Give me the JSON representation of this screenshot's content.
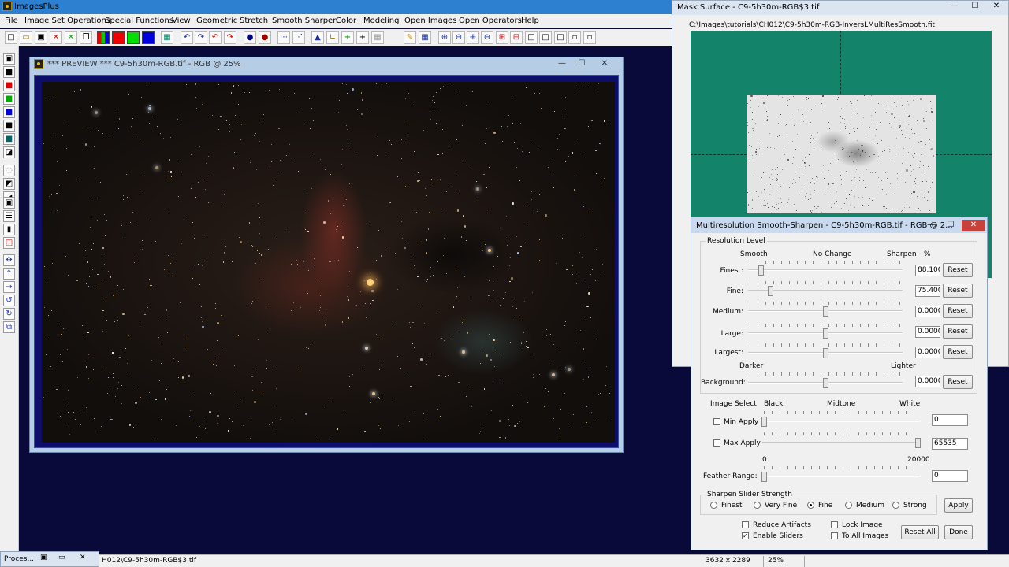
{
  "app": {
    "title": "ImagesPlus"
  },
  "menu": [
    "File",
    "Image Set Operations",
    "Special Functions",
    "View",
    "Geometric",
    "Stretch",
    "Smooth Sharpen",
    "Color",
    "Modeling",
    "Open Images",
    "Open Operators",
    "Help"
  ],
  "window_controls": {
    "minimize": "—",
    "maximize": "☐",
    "close": "✕"
  },
  "preview": {
    "title": "*** PREVIEW *** C9-5h30m-RGB.tif - RGB @ 25%"
  },
  "mask": {
    "title": "Mask Surface - C9-5h30m-RGB$3.tif",
    "path": "C:\\Images\\tutorials\\CH012\\C9-5h30m-RGB-InversLMultiResSmooth.fit",
    "accent": "#13836a"
  },
  "dialog": {
    "title": "Multiresolution Smooth-Sharpen - C9-5h30m-RGB.tif - RGB @ 2...",
    "resolution_level": {
      "group_label": "Resolution Level",
      "col_smooth": "Smooth",
      "col_nochange": "No Change",
      "col_sharpen": "Sharpen",
      "col_percent": "%",
      "rows": [
        {
          "label": "Finest:",
          "value": "88.1006",
          "reset": "Reset"
        },
        {
          "label": "Fine:",
          "value": "75.4000",
          "reset": "Reset"
        },
        {
          "label": "Medium:",
          "value": "0.0000",
          "reset": "Reset"
        },
        {
          "label": "Large:",
          "value": "0.0000",
          "reset": "Reset"
        },
        {
          "label": "Largest:",
          "value": "0.0000",
          "reset": "Reset"
        }
      ],
      "darker": "Darker",
      "lighter": "Lighter",
      "background": {
        "label": "Background:",
        "value": "0.0000",
        "reset": "Reset"
      }
    },
    "image_select": {
      "label": "Image Select",
      "black": "Black",
      "midtone": "Midtone",
      "white": "White",
      "min_apply": {
        "label": "Min Apply",
        "value": "0",
        "checked": false
      },
      "max_apply": {
        "label": "Max Apply",
        "value": "65535",
        "checked": false
      },
      "range_min": "0",
      "range_max": "20000",
      "feather": {
        "label": "Feather Range:",
        "value": "0"
      }
    },
    "strength": {
      "group_label": "Sharpen Slider Strength",
      "options": [
        "Finest",
        "Very Fine",
        "Fine",
        "Medium",
        "Strong"
      ],
      "selected": "Fine",
      "apply": "Apply"
    },
    "options": {
      "reduce_artifacts": {
        "label": "Reduce Artifacts",
        "checked": false
      },
      "enable_sliders": {
        "label": "Enable Sliders",
        "checked": true
      },
      "lock_image": {
        "label": "Lock Image",
        "checked": false
      },
      "to_all_images": {
        "label": "To All Images",
        "checked": false
      }
    },
    "reset_all": "Reset All",
    "done": "Done"
  },
  "statusbar": {
    "path": "H012\\C9-5h30m-RGB$3.tif",
    "dimensions": "3632 x 2289",
    "zoom": "25%"
  },
  "minimized": {
    "label": "Proces..."
  },
  "icons": [
    "new-icon",
    "open-icon",
    "save-icon",
    "close-icon",
    "undo-icon",
    "redo-icon",
    "zoom-in-icon",
    "zoom-out-icon"
  ]
}
